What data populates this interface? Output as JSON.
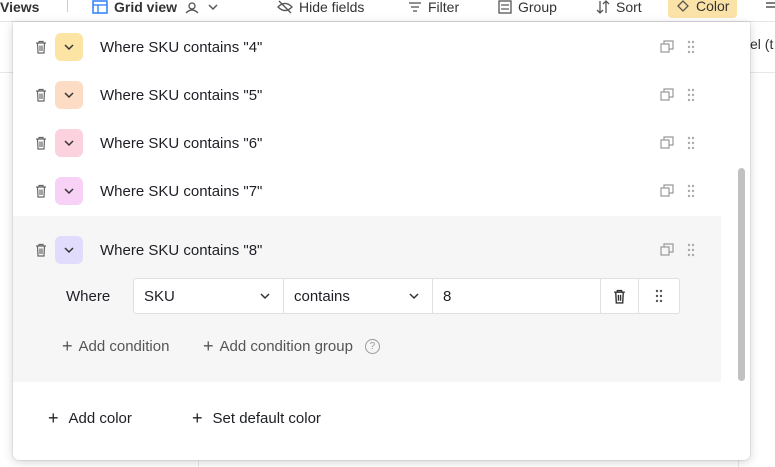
{
  "toolbar": {
    "views_label": "Views",
    "grid_view_label": "Grid view",
    "hide_fields_label": "Hide fields",
    "filter_label": "Filter",
    "group_label": "Group",
    "sort_label": "Sort",
    "color_label": "Color"
  },
  "background": {
    "column_header_fragment": "el (t"
  },
  "rules": [
    {
      "label": "Where SKU contains \"4\"",
      "color": "#fce5a4"
    },
    {
      "label": "Where SKU contains \"5\"",
      "color": "#fddcc5"
    },
    {
      "label": "Where SKU contains \"6\"",
      "color": "#fcd2de"
    },
    {
      "label": "Where SKU contains \"7\"",
      "color": "#f8d2f6"
    },
    {
      "label": "Where SKU contains \"8\"",
      "color": "#e1dcfb"
    }
  ],
  "condition": {
    "where_label": "Where",
    "field": "SKU",
    "operator": "contains",
    "value": "8"
  },
  "actions": {
    "add_condition": "Add condition",
    "add_condition_group": "Add condition group",
    "help": "?"
  },
  "footer": {
    "add_color": "Add color",
    "set_default_color": "Set default color"
  }
}
